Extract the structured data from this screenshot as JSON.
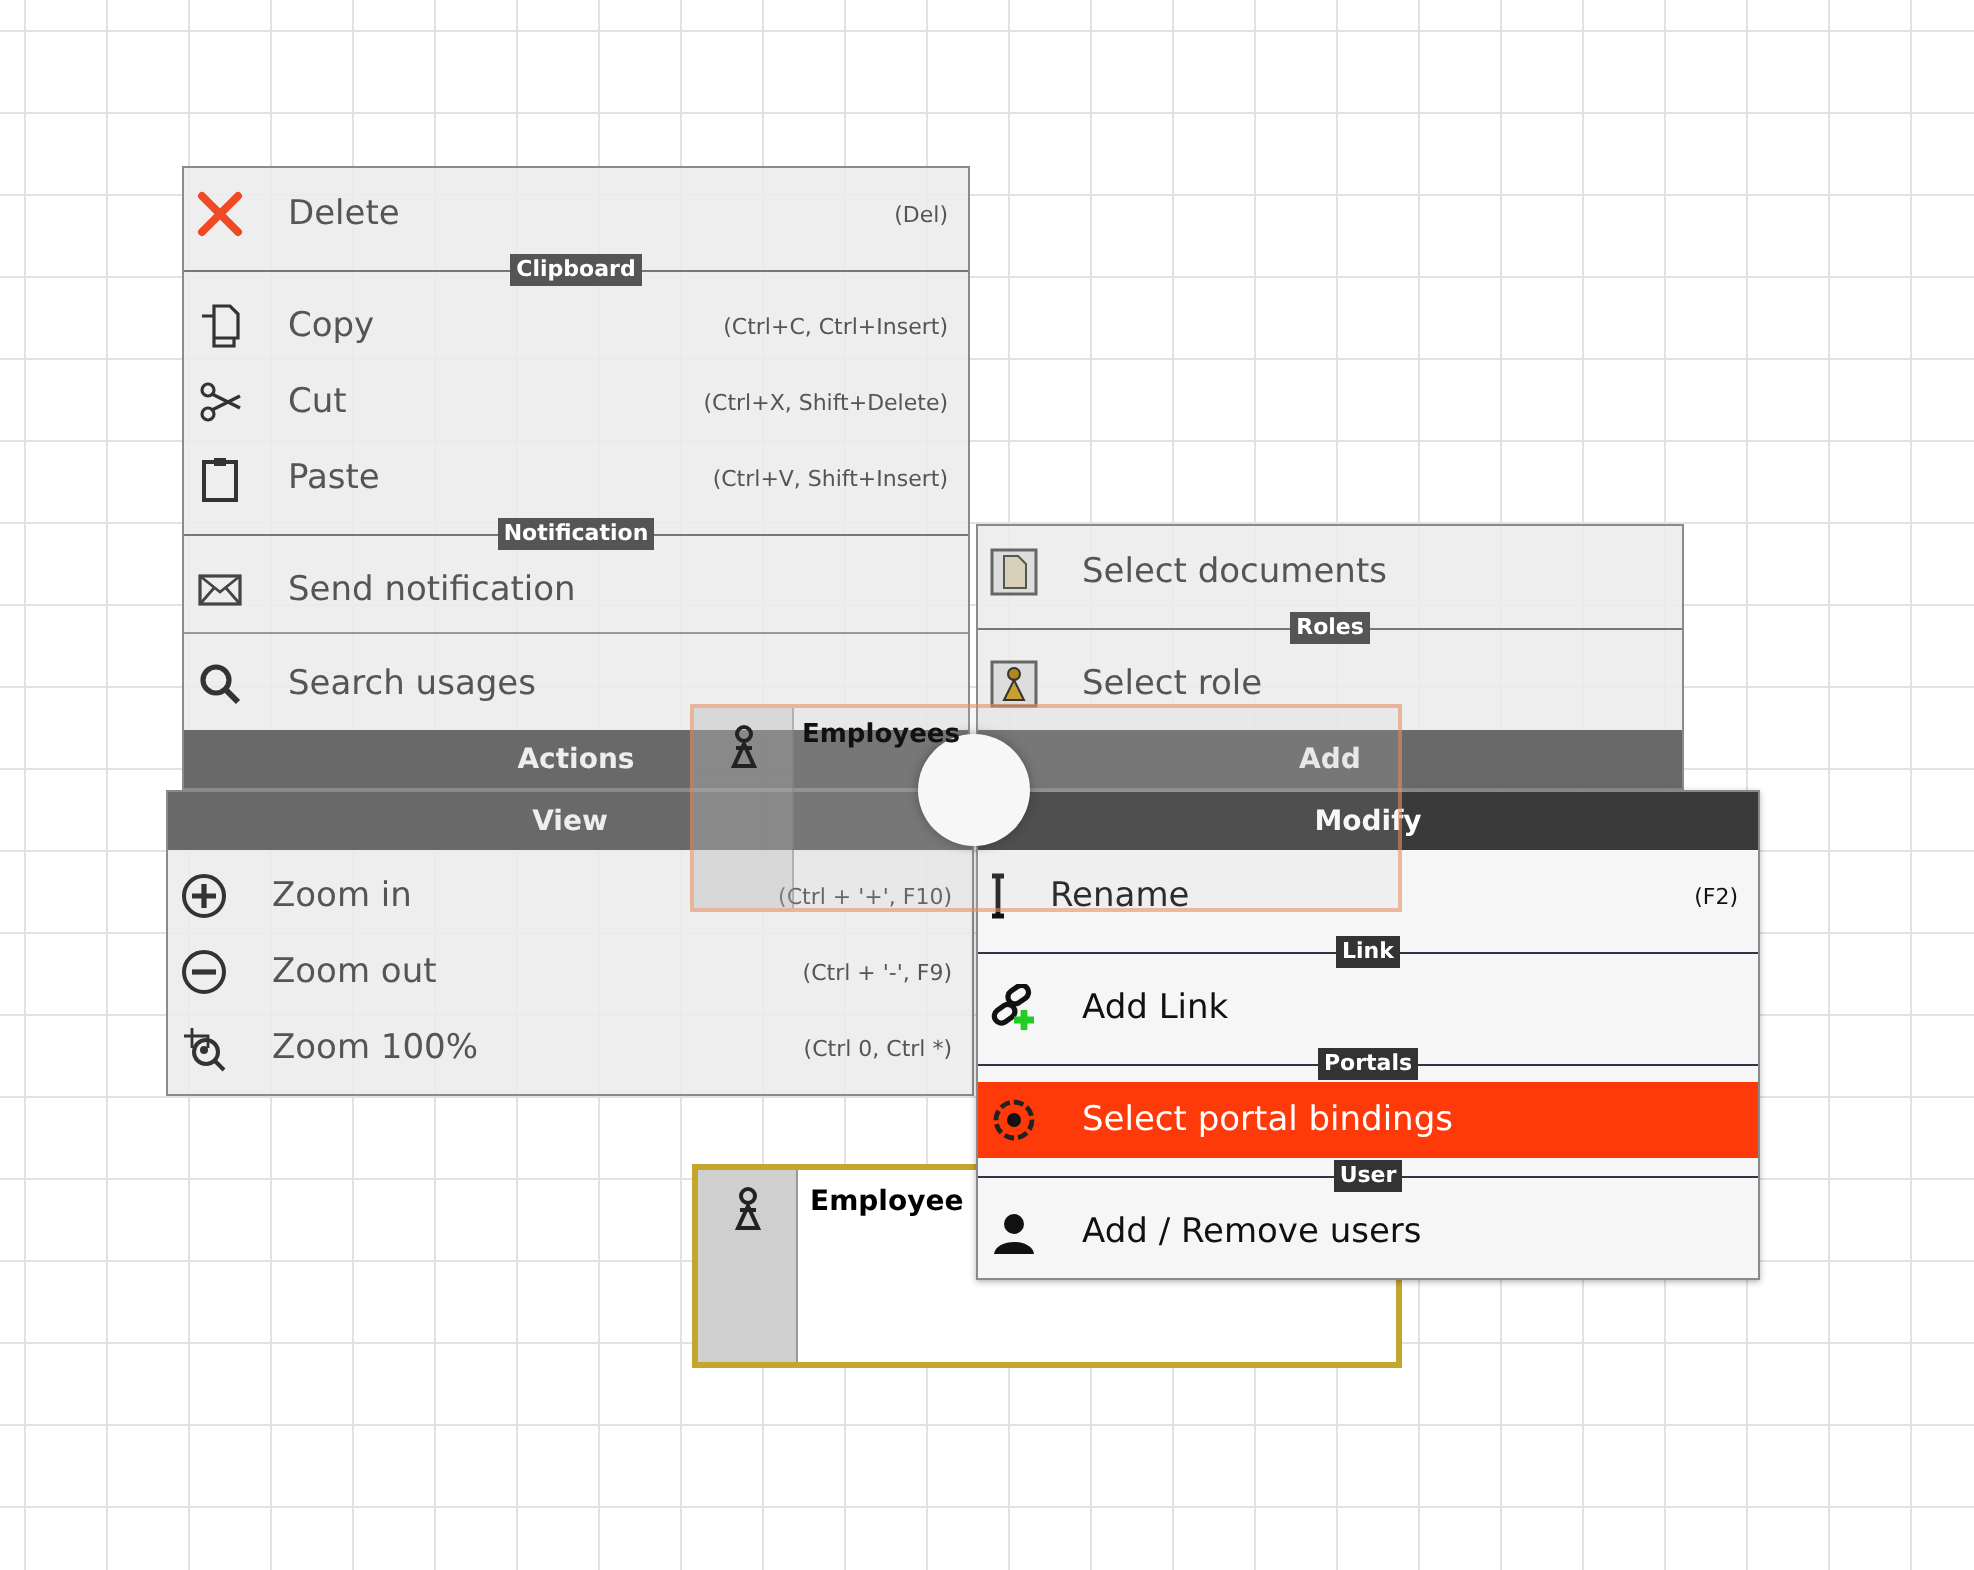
{
  "menus": [
    {
      "title": "Actions",
      "active": false,
      "items": [
        {
          "kind": "item",
          "label": "Delete",
          "shortcut": "(Del)",
          "selected": false
        },
        {
          "kind": "section",
          "label": "Clipboard"
        },
        {
          "kind": "item",
          "label": "Copy",
          "shortcut": "(Ctrl+C, Ctrl+Insert)",
          "selected": false
        },
        {
          "kind": "item",
          "label": "Cut",
          "shortcut": "(Ctrl+X, Shift+Delete)",
          "selected": false
        },
        {
          "kind": "item",
          "label": "Paste",
          "shortcut": "(Ctrl+V, Shift+Insert)",
          "selected": false
        },
        {
          "kind": "section",
          "label": "Notification"
        },
        {
          "kind": "item",
          "label": "Send notification",
          "selected": false
        },
        {
          "kind": "divider"
        },
        {
          "kind": "item",
          "label": "Search usages",
          "selected": false
        }
      ]
    },
    {
      "title": "Add",
      "active": false,
      "items": [
        {
          "kind": "item",
          "label": "Select documents",
          "selected": false
        },
        {
          "kind": "section",
          "label": "Roles"
        },
        {
          "kind": "item",
          "label": "Select role",
          "selected": false
        }
      ]
    },
    {
      "title": "View",
      "active": false,
      "items": [
        {
          "kind": "item",
          "label": "Zoom in",
          "shortcut": "(Ctrl + '+', F10)",
          "selected": false
        },
        {
          "kind": "item",
          "label": "Zoom out",
          "shortcut": "(Ctrl + '-', F9)",
          "selected": false
        },
        {
          "kind": "item",
          "label": "Zoom 100%",
          "shortcut": "(Ctrl 0, Ctrl *)",
          "selected": false
        }
      ]
    },
    {
      "title": "Modify",
      "active": true,
      "items": [
        {
          "kind": "item",
          "label": "Rename",
          "shortcut": "(F2)",
          "selected": false
        },
        {
          "kind": "section",
          "label": "Link"
        },
        {
          "kind": "item",
          "label": "Add Link",
          "selected": false
        },
        {
          "kind": "section",
          "label": "Portals"
        },
        {
          "kind": "item",
          "label": "Select portal bindings",
          "selected": true
        },
        {
          "kind": "section",
          "label": "User"
        },
        {
          "kind": "item",
          "label": "Add / Remove users",
          "selected": false
        }
      ]
    }
  ],
  "ghost_node": {
    "label": "Employees"
  },
  "node": {
    "label": "Employee"
  }
}
